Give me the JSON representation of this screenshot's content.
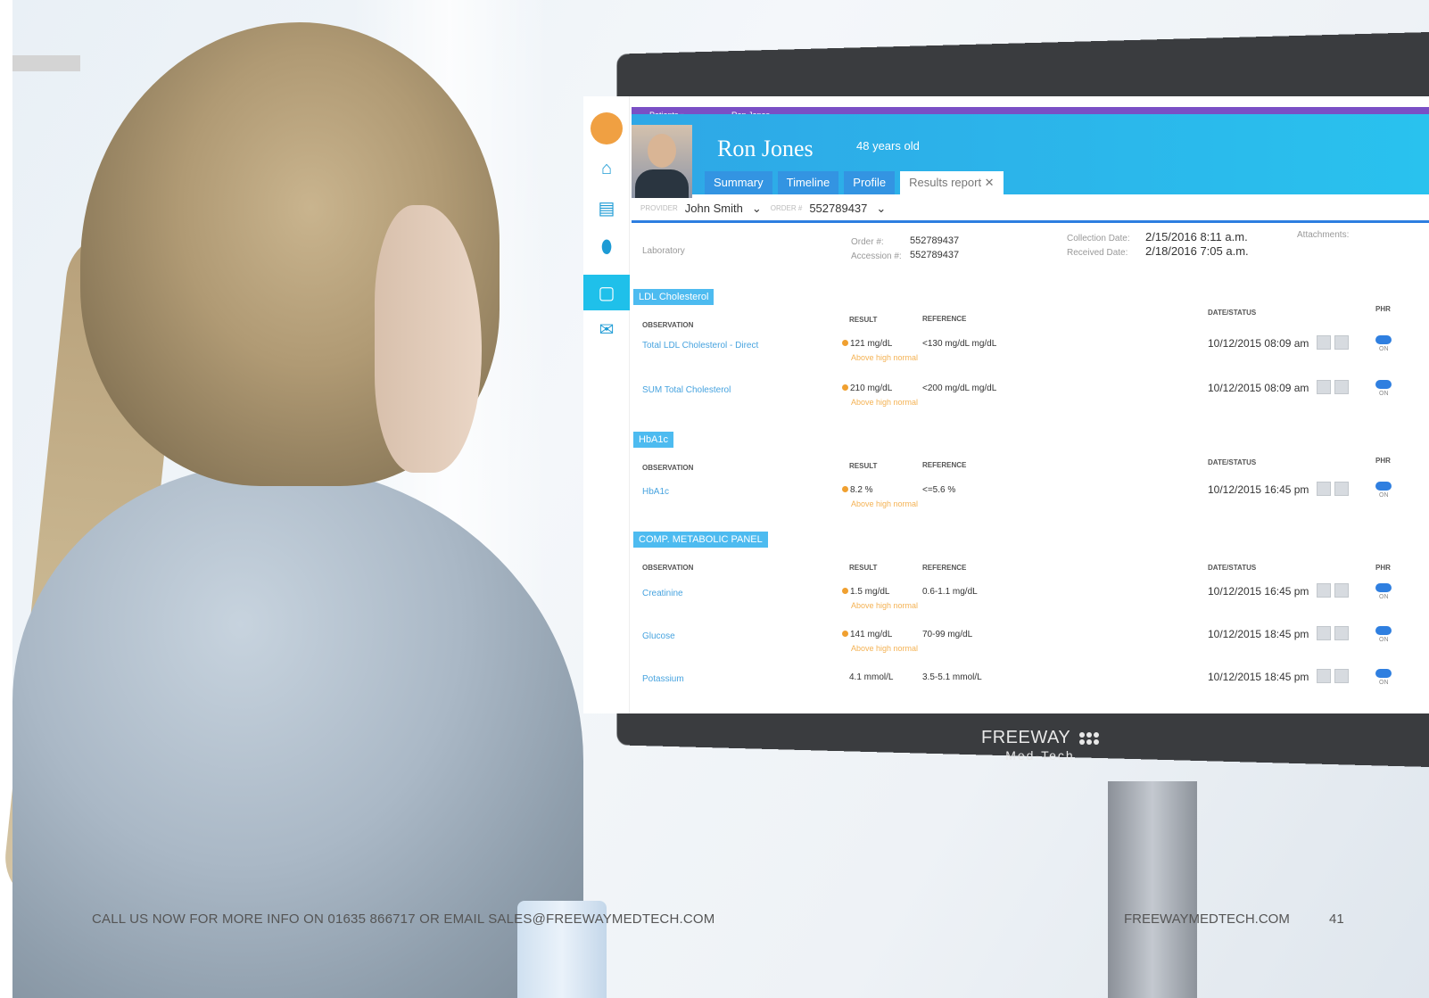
{
  "patient": {
    "breadcrumb_patients": "Patients »",
    "breadcrumb_name": "Ron Jones",
    "name": "Ron Jones",
    "age": "48 years old",
    "tabs": [
      "Summary",
      "Timeline",
      "Profile",
      "Results report ✕"
    ],
    "provider_label": "PROVIDER",
    "provider_value": "John Smith",
    "order_label": "ORDER #",
    "order_value": "552789437"
  },
  "order_info": {
    "lab_label": "Laboratory",
    "order_no_label": "Order #:",
    "order_no_value": "552789437",
    "accession_label": "Accession #:",
    "accession_value": "552789437",
    "collection_label": "Collection Date:",
    "collection_value": "2/15/2016 8:11 a.m.",
    "received_label": "Received Date:",
    "received_value": "2/18/2016 7:05 a.m.",
    "attachments_label": "Attachments:"
  },
  "columns": {
    "observation": "OBSERVATION",
    "result": "RESULT",
    "reference": "REFERENCE",
    "date_status": "DATE/STATUS",
    "phr": "PHR",
    "on": "ON"
  },
  "sections": [
    {
      "title": "LDL Cholesterol",
      "rows": [
        {
          "obs": "Total LDL Cholesterol - Direct",
          "result": "121 mg/dL",
          "flag": "Above high normal",
          "ref": "<130 mg/dL mg/dL",
          "date": "10/12/2015 08:09 am"
        },
        {
          "obs": "SUM Total Cholesterol",
          "result": "210 mg/dL",
          "flag": "Above high normal",
          "ref": "<200 mg/dL mg/dL",
          "date": "10/12/2015 08:09 am"
        }
      ]
    },
    {
      "title": "HbA1c",
      "rows": [
        {
          "obs": "HbA1c",
          "result": "8.2 %",
          "flag": "Above high normal",
          "ref": "<=5.6 %",
          "date": "10/12/2015 16:45 pm"
        }
      ]
    },
    {
      "title": "COMP. METABOLIC PANEL",
      "rows": [
        {
          "obs": "Creatinine",
          "result": "1.5 mg/dL",
          "flag": "Above high normal",
          "ref": "0.6-1.1 mg/dL",
          "date": "10/12/2015 16:45 pm"
        },
        {
          "obs": "Glucose",
          "result": "141 mg/dL",
          "flag": "Above high normal",
          "ref": "70-99 mg/dL",
          "date": "10/12/2015 18:45 pm"
        },
        {
          "obs": "Potassium",
          "result": "4.1 mmol/L",
          "flag": "",
          "ref": "3.5-5.1 mmol/L",
          "date": "10/12/2015 18:45 pm"
        }
      ]
    }
  ],
  "branding": {
    "brand_top": "FREEWAY",
    "brand_bottom": "Med-Tech"
  },
  "footer": {
    "contact": "CALL US NOW FOR MORE INFO ON 01635 866717 OR EMAIL SALES@FREEWAYMEDTECH.COM",
    "website": "FREEWAYMEDTECH.COM",
    "page": "41"
  },
  "colors": {
    "accent": "#29c2ee",
    "purple": "#7a4fc5",
    "flag": "#f4b254"
  }
}
